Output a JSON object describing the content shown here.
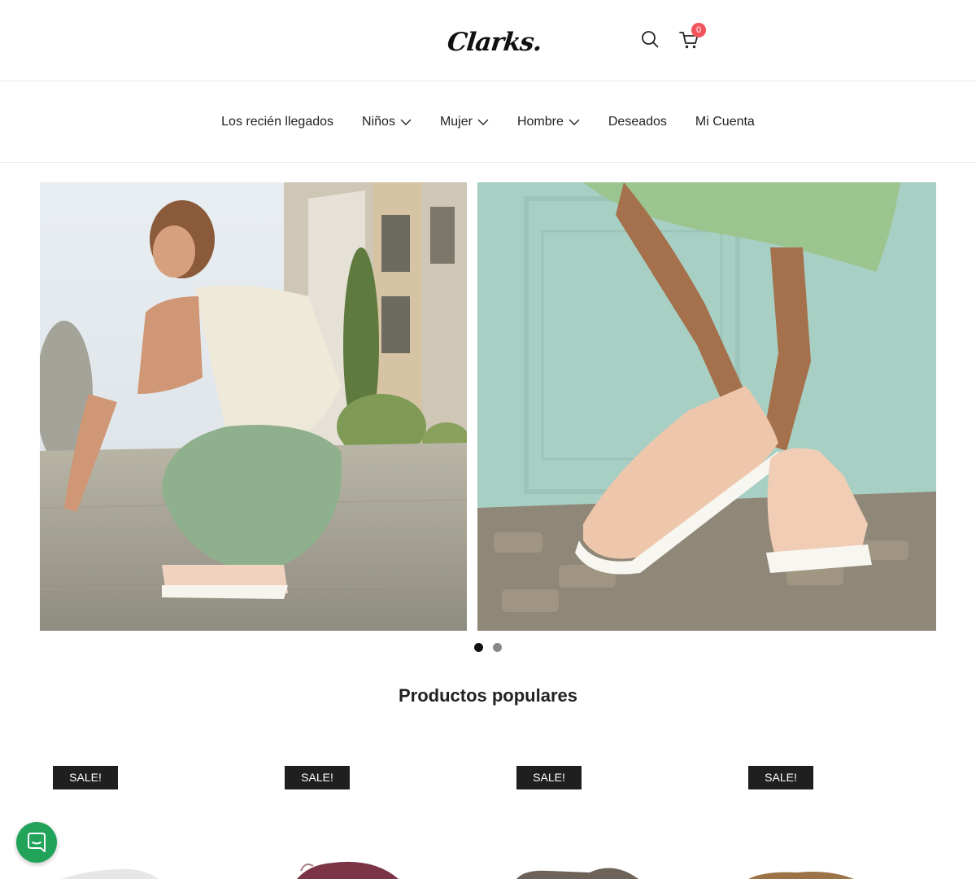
{
  "header": {
    "logo_text": "Clarks.",
    "cart_count": "0",
    "icons": [
      "search-icon",
      "cart-icon"
    ]
  },
  "nav": {
    "items": [
      {
        "label": "Los recién llegados",
        "has_dropdown": false
      },
      {
        "label": "Niños",
        "has_dropdown": true
      },
      {
        "label": "Mujer",
        "has_dropdown": true
      },
      {
        "label": "Hombre",
        "has_dropdown": true
      },
      {
        "label": "Deseados",
        "has_dropdown": false
      },
      {
        "label": "Mi Cuenta",
        "has_dropdown": false
      }
    ]
  },
  "hero": {
    "slide_count": 2,
    "active_slide": 1
  },
  "popular": {
    "title": "Productos populares",
    "products": [
      {
        "badge": "SALE!"
      },
      {
        "badge": "SALE!"
      },
      {
        "badge": "SALE!"
      },
      {
        "badge": "SALE!"
      }
    ]
  },
  "colors": {
    "cart_badge": "#f2545b",
    "sale_badge": "#1f1f1f",
    "chat_button": "#22a35a"
  }
}
